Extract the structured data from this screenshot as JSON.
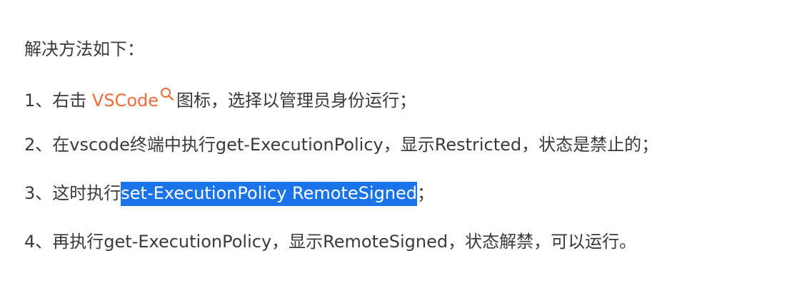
{
  "article": {
    "intro": "解决方法如下：",
    "step1": {
      "prefix": "1、右击 ",
      "link": "VSCode",
      "search_icon": "search-icon",
      "suffix": "图标，选择以管理员身份运行；"
    },
    "step2": {
      "text": "2、在vscode终端中执行get-ExecutionPolicy，显示Restricted，状态是禁止的；"
    },
    "step3": {
      "prefix": "3、这时执行",
      "selected": "set-ExecutionPolicy RemoteSigned",
      "suffix": "；"
    },
    "step4": {
      "text": "4、再执行get-ExecutionPolicy，显示RemoteSigned，状态解禁，可以运行。"
    }
  },
  "colors": {
    "text": "#3a3a3a",
    "link": "#f06b3a",
    "selection": "#1a73e8"
  }
}
